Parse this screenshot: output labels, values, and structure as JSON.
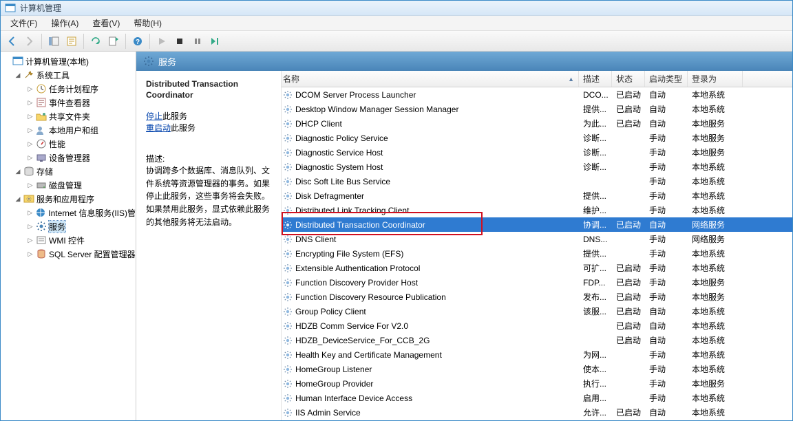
{
  "window": {
    "title": "计算机管理"
  },
  "menubar": [
    "文件(F)",
    "操作(A)",
    "查看(V)",
    "帮助(H)"
  ],
  "tree": {
    "root": "计算机管理(本地)",
    "groups": [
      {
        "label": "系统工具",
        "icon": "tools",
        "children": [
          {
            "label": "任务计划程序",
            "icon": "clock"
          },
          {
            "label": "事件查看器",
            "icon": "event"
          },
          {
            "label": "共享文件夹",
            "icon": "share"
          },
          {
            "label": "本地用户和组",
            "icon": "users"
          },
          {
            "label": "性能",
            "icon": "perf"
          },
          {
            "label": "设备管理器",
            "icon": "device"
          }
        ]
      },
      {
        "label": "存储",
        "icon": "storage",
        "children": [
          {
            "label": "磁盘管理",
            "icon": "disk"
          }
        ]
      },
      {
        "label": "服务和应用程序",
        "icon": "apps",
        "children": [
          {
            "label": "Internet 信息服务(IIS)管",
            "icon": "iis"
          },
          {
            "label": "服务",
            "icon": "gear",
            "selected": true
          },
          {
            "label": "WMI 控件",
            "icon": "wmi"
          },
          {
            "label": "SQL Server 配置管理器",
            "icon": "sql"
          }
        ]
      }
    ]
  },
  "header": {
    "title": "服务"
  },
  "detail": {
    "title": "Distributed Transaction Coordinator",
    "stop_label": "停止",
    "stop_suffix": "此服务",
    "restart_label": "重启动",
    "restart_suffix": "此服务",
    "desc_label": "描述:",
    "desc_text": "协调跨多个数据库、消息队列、文件系统等资源管理器的事务。如果停止此服务，这些事务将会失败。如果禁用此服务，显式依赖此服务的其他服务将无法启动。"
  },
  "columns": {
    "name": "名称",
    "desc": "描述",
    "state": "状态",
    "start": "启动类型",
    "logon": "登录为"
  },
  "services": [
    {
      "name": "DCOM Server Process Launcher",
      "desc": "DCO...",
      "state": "已启动",
      "start": "自动",
      "logon": "本地系统"
    },
    {
      "name": "Desktop Window Manager Session Manager",
      "desc": "提供...",
      "state": "已启动",
      "start": "自动",
      "logon": "本地系统"
    },
    {
      "name": "DHCP Client",
      "desc": "为此...",
      "state": "已启动",
      "start": "自动",
      "logon": "本地服务"
    },
    {
      "name": "Diagnostic Policy Service",
      "desc": "诊断...",
      "state": "",
      "start": "手动",
      "logon": "本地服务"
    },
    {
      "name": "Diagnostic Service Host",
      "desc": "诊断...",
      "state": "",
      "start": "手动",
      "logon": "本地服务"
    },
    {
      "name": "Diagnostic System Host",
      "desc": "诊断...",
      "state": "",
      "start": "手动",
      "logon": "本地系统"
    },
    {
      "name": "Disc Soft Lite Bus Service",
      "desc": "",
      "state": "",
      "start": "手动",
      "logon": "本地系统"
    },
    {
      "name": "Disk Defragmenter",
      "desc": "提供...",
      "state": "",
      "start": "手动",
      "logon": "本地系统"
    },
    {
      "name": "Distributed Link Tracking Client",
      "desc": "维护...",
      "state": "",
      "start": "手动",
      "logon": "本地系统"
    },
    {
      "name": "Distributed Transaction Coordinator",
      "desc": "协调...",
      "state": "已启动",
      "start": "自动",
      "logon": "网络服务",
      "selected": true
    },
    {
      "name": "DNS Client",
      "desc": "DNS...",
      "state": "",
      "start": "手动",
      "logon": "网络服务"
    },
    {
      "name": "Encrypting File System (EFS)",
      "desc": "提供...",
      "state": "",
      "start": "手动",
      "logon": "本地系统"
    },
    {
      "name": "Extensible Authentication Protocol",
      "desc": "可扩...",
      "state": "已启动",
      "start": "手动",
      "logon": "本地系统"
    },
    {
      "name": "Function Discovery Provider Host",
      "desc": "FDP...",
      "state": "已启动",
      "start": "手动",
      "logon": "本地服务"
    },
    {
      "name": "Function Discovery Resource Publication",
      "desc": "发布...",
      "state": "已启动",
      "start": "手动",
      "logon": "本地服务"
    },
    {
      "name": "Group Policy Client",
      "desc": "该服...",
      "state": "已启动",
      "start": "自动",
      "logon": "本地系统"
    },
    {
      "name": "HDZB Comm Service For V2.0",
      "desc": "",
      "state": "已启动",
      "start": "自动",
      "logon": "本地系统"
    },
    {
      "name": "HDZB_DeviceService_For_CCB_2G",
      "desc": "",
      "state": "已启动",
      "start": "自动",
      "logon": "本地系统"
    },
    {
      "name": "Health Key and Certificate Management",
      "desc": "为网...",
      "state": "",
      "start": "手动",
      "logon": "本地系统"
    },
    {
      "name": "HomeGroup Listener",
      "desc": "使本...",
      "state": "",
      "start": "手动",
      "logon": "本地系统"
    },
    {
      "name": "HomeGroup Provider",
      "desc": "执行...",
      "state": "",
      "start": "手动",
      "logon": "本地服务"
    },
    {
      "name": "Human Interface Device Access",
      "desc": "启用...",
      "state": "",
      "start": "手动",
      "logon": "本地系统"
    },
    {
      "name": "IIS Admin Service",
      "desc": "允许...",
      "state": "已启动",
      "start": "自动",
      "logon": "本地系统"
    }
  ]
}
